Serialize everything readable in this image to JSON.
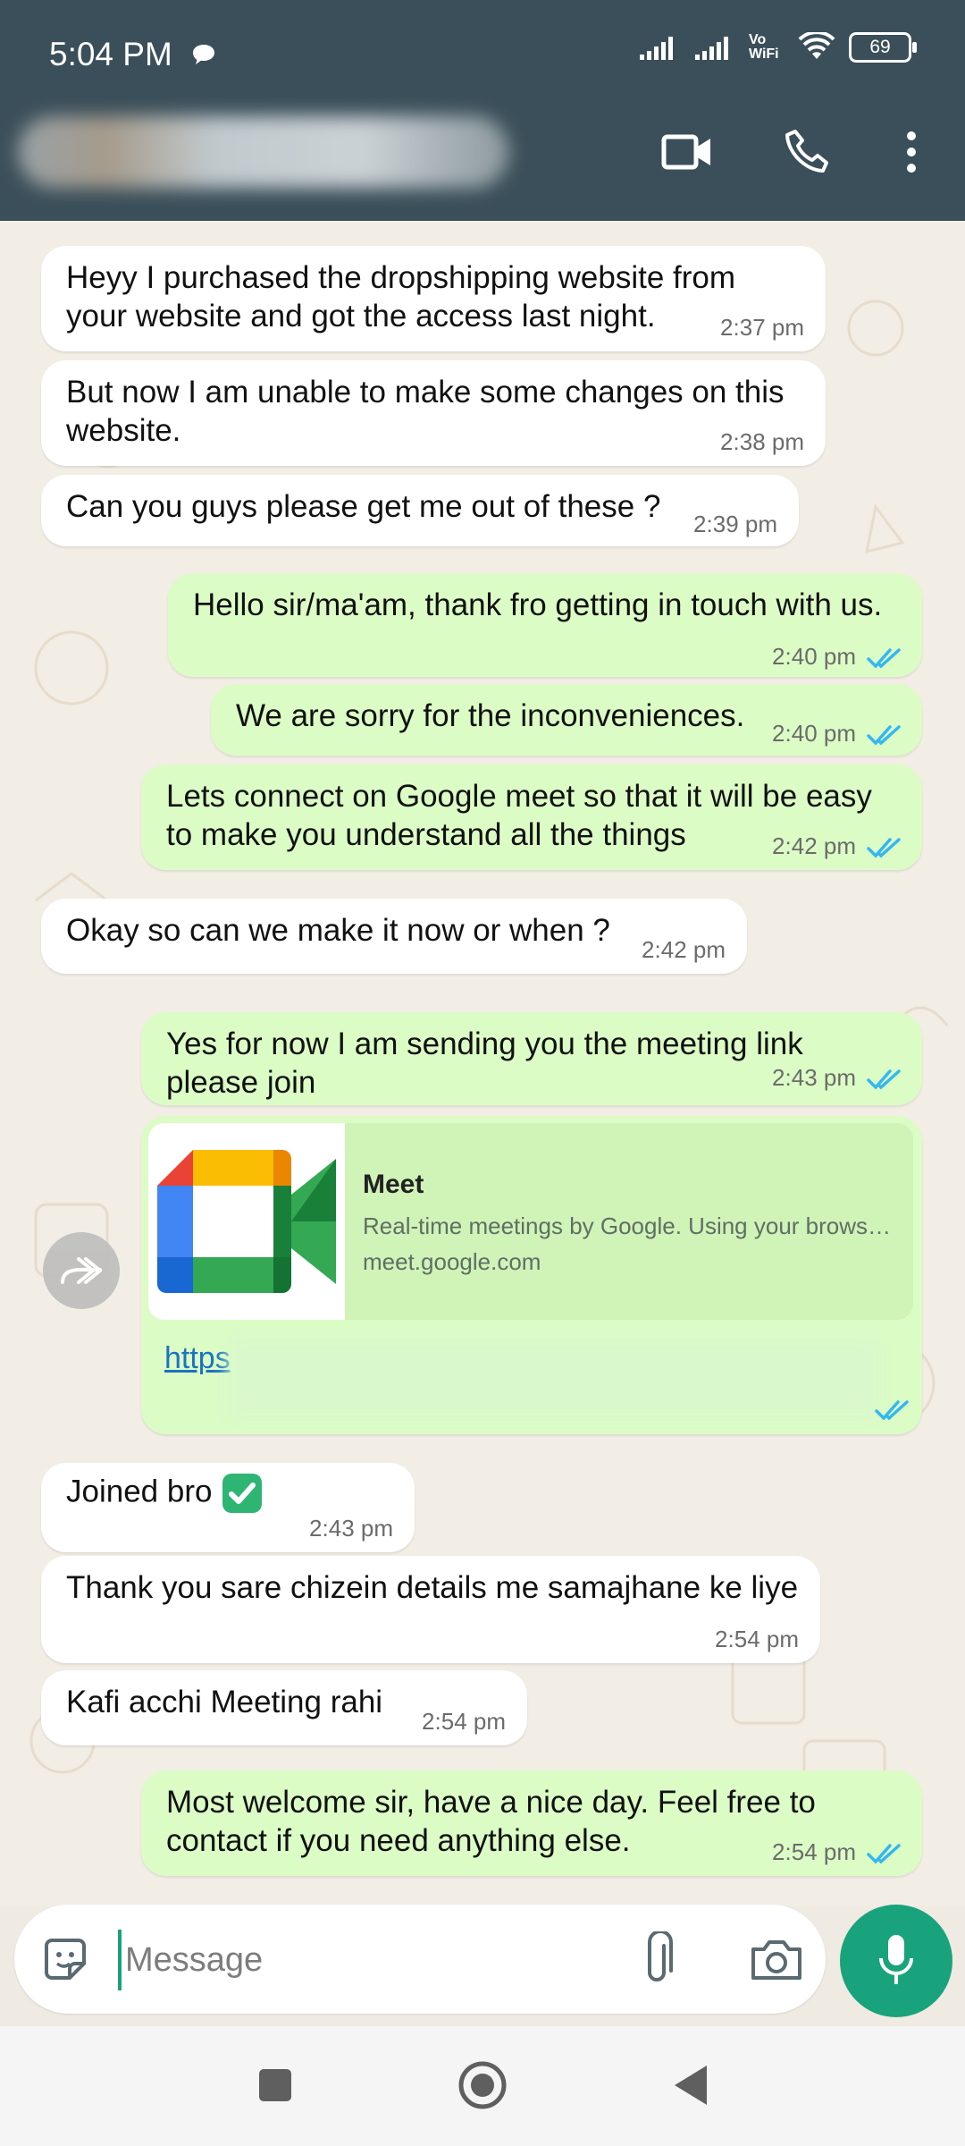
{
  "status_bar": {
    "time": "5:04 PM",
    "network_label": "Vo WiFi",
    "battery": "69"
  },
  "app_bar": {
    "icons": [
      "video-call-icon",
      "voice-call-icon",
      "more-options-icon"
    ]
  },
  "messages": [
    {
      "dir": "in",
      "text": [
        "Heyy I purchased the dropshipping website from",
        "your website and got the access last night."
      ],
      "time": "2:37 pm"
    },
    {
      "dir": "in",
      "text": [
        "But now I am unable to make some changes on this",
        "website."
      ],
      "time": "2:38 pm"
    },
    {
      "dir": "in",
      "text": [
        "Can you guys please get me out of these ?"
      ],
      "time": "2:39 pm"
    },
    {
      "dir": "out",
      "text": [
        "Hello sir/ma'am, thank fro getting in touch with us."
      ],
      "time": "2:40 pm"
    },
    {
      "dir": "out",
      "text": [
        "We are sorry for the inconveniences."
      ],
      "time": "2:40 pm"
    },
    {
      "dir": "out",
      "text": [
        "Lets connect on Google meet so that it will be easy",
        "to make you understand all the things"
      ],
      "time": "2:42 pm"
    },
    {
      "dir": "in",
      "text": [
        "Okay so can we make it now or when ?"
      ],
      "time": "2:42 pm"
    },
    {
      "dir": "out",
      "text": [
        "Yes for now I am sending you the meeting link",
        "please join"
      ],
      "time": "2:43 pm"
    },
    {
      "dir": "in",
      "text": [
        "Joined bro"
      ],
      "time": "2:43 pm"
    },
    {
      "dir": "in",
      "text": [
        "Thank you sare chizein details me samajhane ke liye"
      ],
      "time": "2:54 pm"
    },
    {
      "dir": "in",
      "text": [
        "Kafi acchi Meeting rahi"
      ],
      "time": "2:54 pm"
    },
    {
      "dir": "out",
      "text": [
        "Most welcome sir, have a nice day. Feel free to",
        "contact if you need anything else."
      ],
      "time": "2:54 pm"
    }
  ],
  "link_preview": {
    "title": "Meet",
    "description": "Real-time meetings by Google. Using your brows…",
    "domain": "meet.google.com",
    "url_visible": "https"
  },
  "composer": {
    "placeholder": "Message"
  },
  "colors": {
    "app_bar": "#3b4f5a",
    "incoming": "#ffffff",
    "outgoing": "#dcfcc6",
    "accent": "#19a37c",
    "read_ticks": "#34b7f1"
  }
}
